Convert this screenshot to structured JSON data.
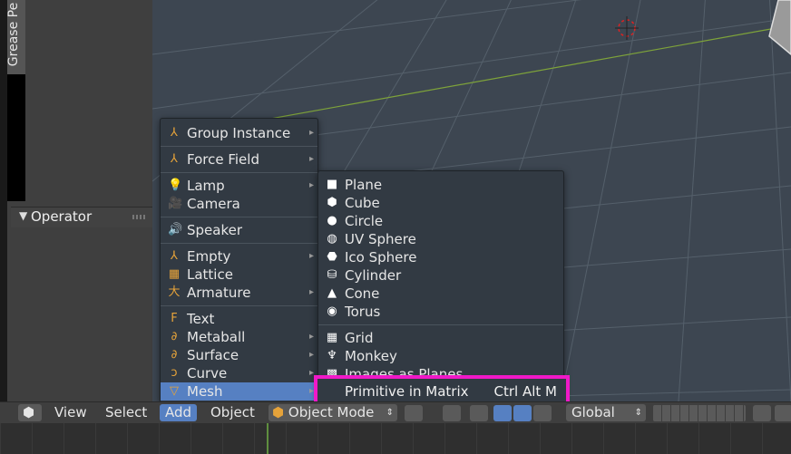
{
  "left_panel": {
    "grease_pencil_tab": "Grease Pe",
    "operator_label": "Operator"
  },
  "add_menu": {
    "items": [
      {
        "label": "Group Instance",
        "icon": "group-instance-icon",
        "glyph": "⅄",
        "has_submenu": true
      },
      {
        "label": "Force Field",
        "icon": "force-field-icon",
        "glyph": "⅄",
        "has_submenu": true
      },
      {
        "label": "Lamp",
        "icon": "lamp-icon",
        "glyph": "💡",
        "has_submenu": true
      },
      {
        "label": "Camera",
        "icon": "camera-icon",
        "glyph": "🎥",
        "has_submenu": false
      },
      {
        "label": "Speaker",
        "icon": "speaker-icon",
        "glyph": "🔊",
        "has_submenu": false
      },
      {
        "label": "Empty",
        "icon": "empty-icon",
        "glyph": "⅄",
        "has_submenu": true
      },
      {
        "label": "Lattice",
        "icon": "lattice-icon",
        "glyph": "▦",
        "has_submenu": false
      },
      {
        "label": "Armature",
        "icon": "armature-icon",
        "glyph": "大",
        "has_submenu": true
      },
      {
        "label": "Text",
        "icon": "text-icon",
        "glyph": "F",
        "has_submenu": false
      },
      {
        "label": "Metaball",
        "icon": "metaball-icon",
        "glyph": "∂",
        "has_submenu": true
      },
      {
        "label": "Surface",
        "icon": "surface-icon",
        "glyph": "∂",
        "has_submenu": true
      },
      {
        "label": "Curve",
        "icon": "curve-icon",
        "glyph": "ↄ",
        "has_submenu": true
      },
      {
        "label": "Mesh",
        "icon": "mesh-icon",
        "glyph": "▽",
        "has_submenu": true
      }
    ]
  },
  "mesh_menu": {
    "items": [
      {
        "label": "Plane",
        "icon": "plane-icon",
        "glyph": "■"
      },
      {
        "label": "Cube",
        "icon": "cube-icon",
        "glyph": "⬢"
      },
      {
        "label": "Circle",
        "icon": "circle-icon",
        "glyph": "●"
      },
      {
        "label": "UV Sphere",
        "icon": "uv-sphere-icon",
        "glyph": "◍"
      },
      {
        "label": "Ico Sphere",
        "icon": "ico-sphere-icon",
        "glyph": "⬣"
      },
      {
        "label": "Cylinder",
        "icon": "cylinder-icon",
        "glyph": "⛁"
      },
      {
        "label": "Cone",
        "icon": "cone-icon",
        "glyph": "▲"
      },
      {
        "label": "Torus",
        "icon": "torus-icon",
        "glyph": "◉"
      },
      {
        "label": "Grid",
        "icon": "grid-icon",
        "glyph": "▦"
      },
      {
        "label": "Monkey",
        "icon": "monkey-icon",
        "glyph": "♆"
      },
      {
        "label": "Images as Planes",
        "icon": "images-as-planes-icon",
        "glyph": "▩"
      }
    ],
    "highlighted_item": {
      "label": "Primitive in Matrix",
      "shortcut": "Ctrl Alt M"
    }
  },
  "header": {
    "view": "View",
    "select": "Select",
    "add": "Add",
    "object": "Object",
    "mode": "Object Mode",
    "orientation": "Global"
  },
  "colors": {
    "highlight": "#5680c2",
    "annotation_box": "#f019c8",
    "menu_bg": "#323a43",
    "viewport_bg": "#3d4651"
  }
}
